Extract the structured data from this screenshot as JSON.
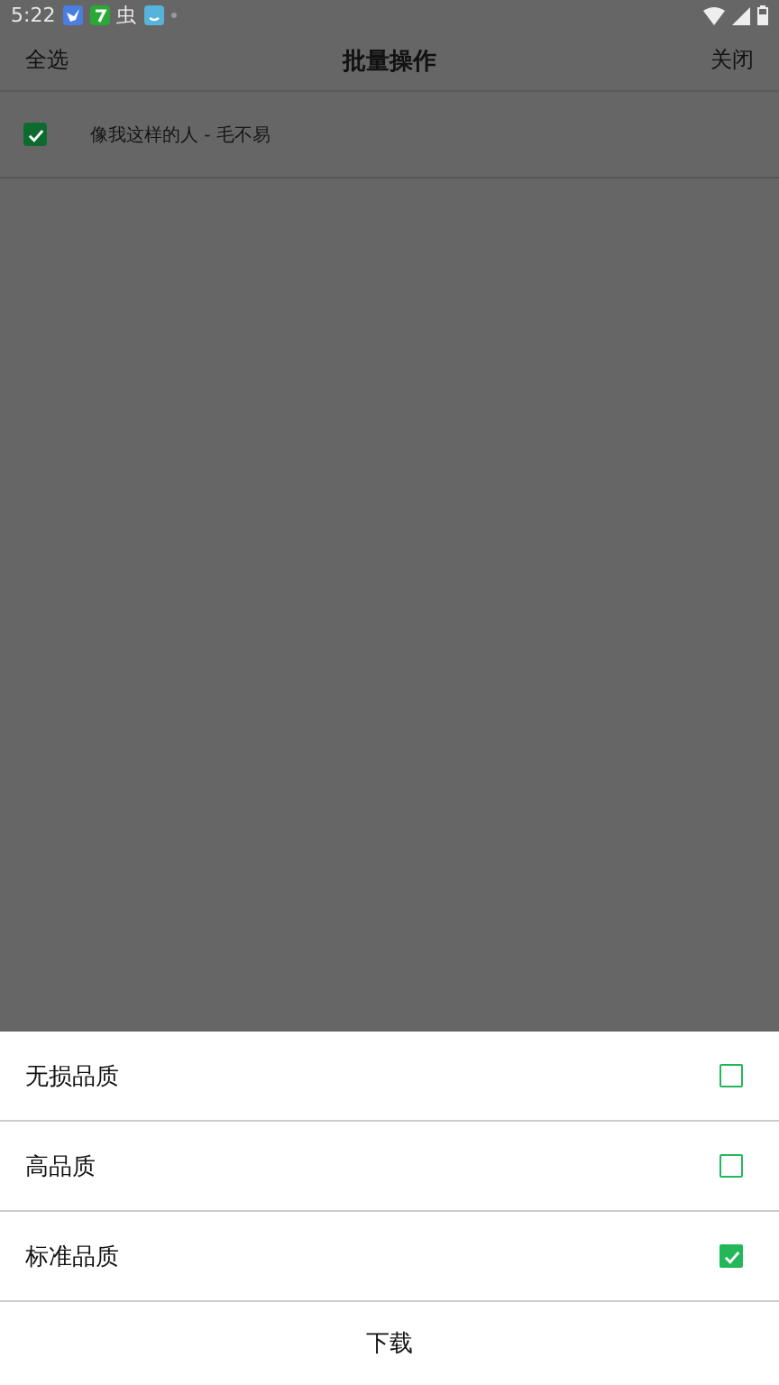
{
  "status_bar": {
    "time": "5:22",
    "glyph_icon": "虫"
  },
  "header": {
    "left_action": "全选",
    "title": "批量操作",
    "right_action": "关闭"
  },
  "songs": [
    {
      "title": "像我这样的人 - 毛不易",
      "checked": true
    }
  ],
  "quality_sheet": {
    "options": [
      {
        "label": "无损品质",
        "selected": false
      },
      {
        "label": "高品质",
        "selected": false
      },
      {
        "label": "标准品质",
        "selected": true
      }
    ],
    "confirm": "下载"
  }
}
